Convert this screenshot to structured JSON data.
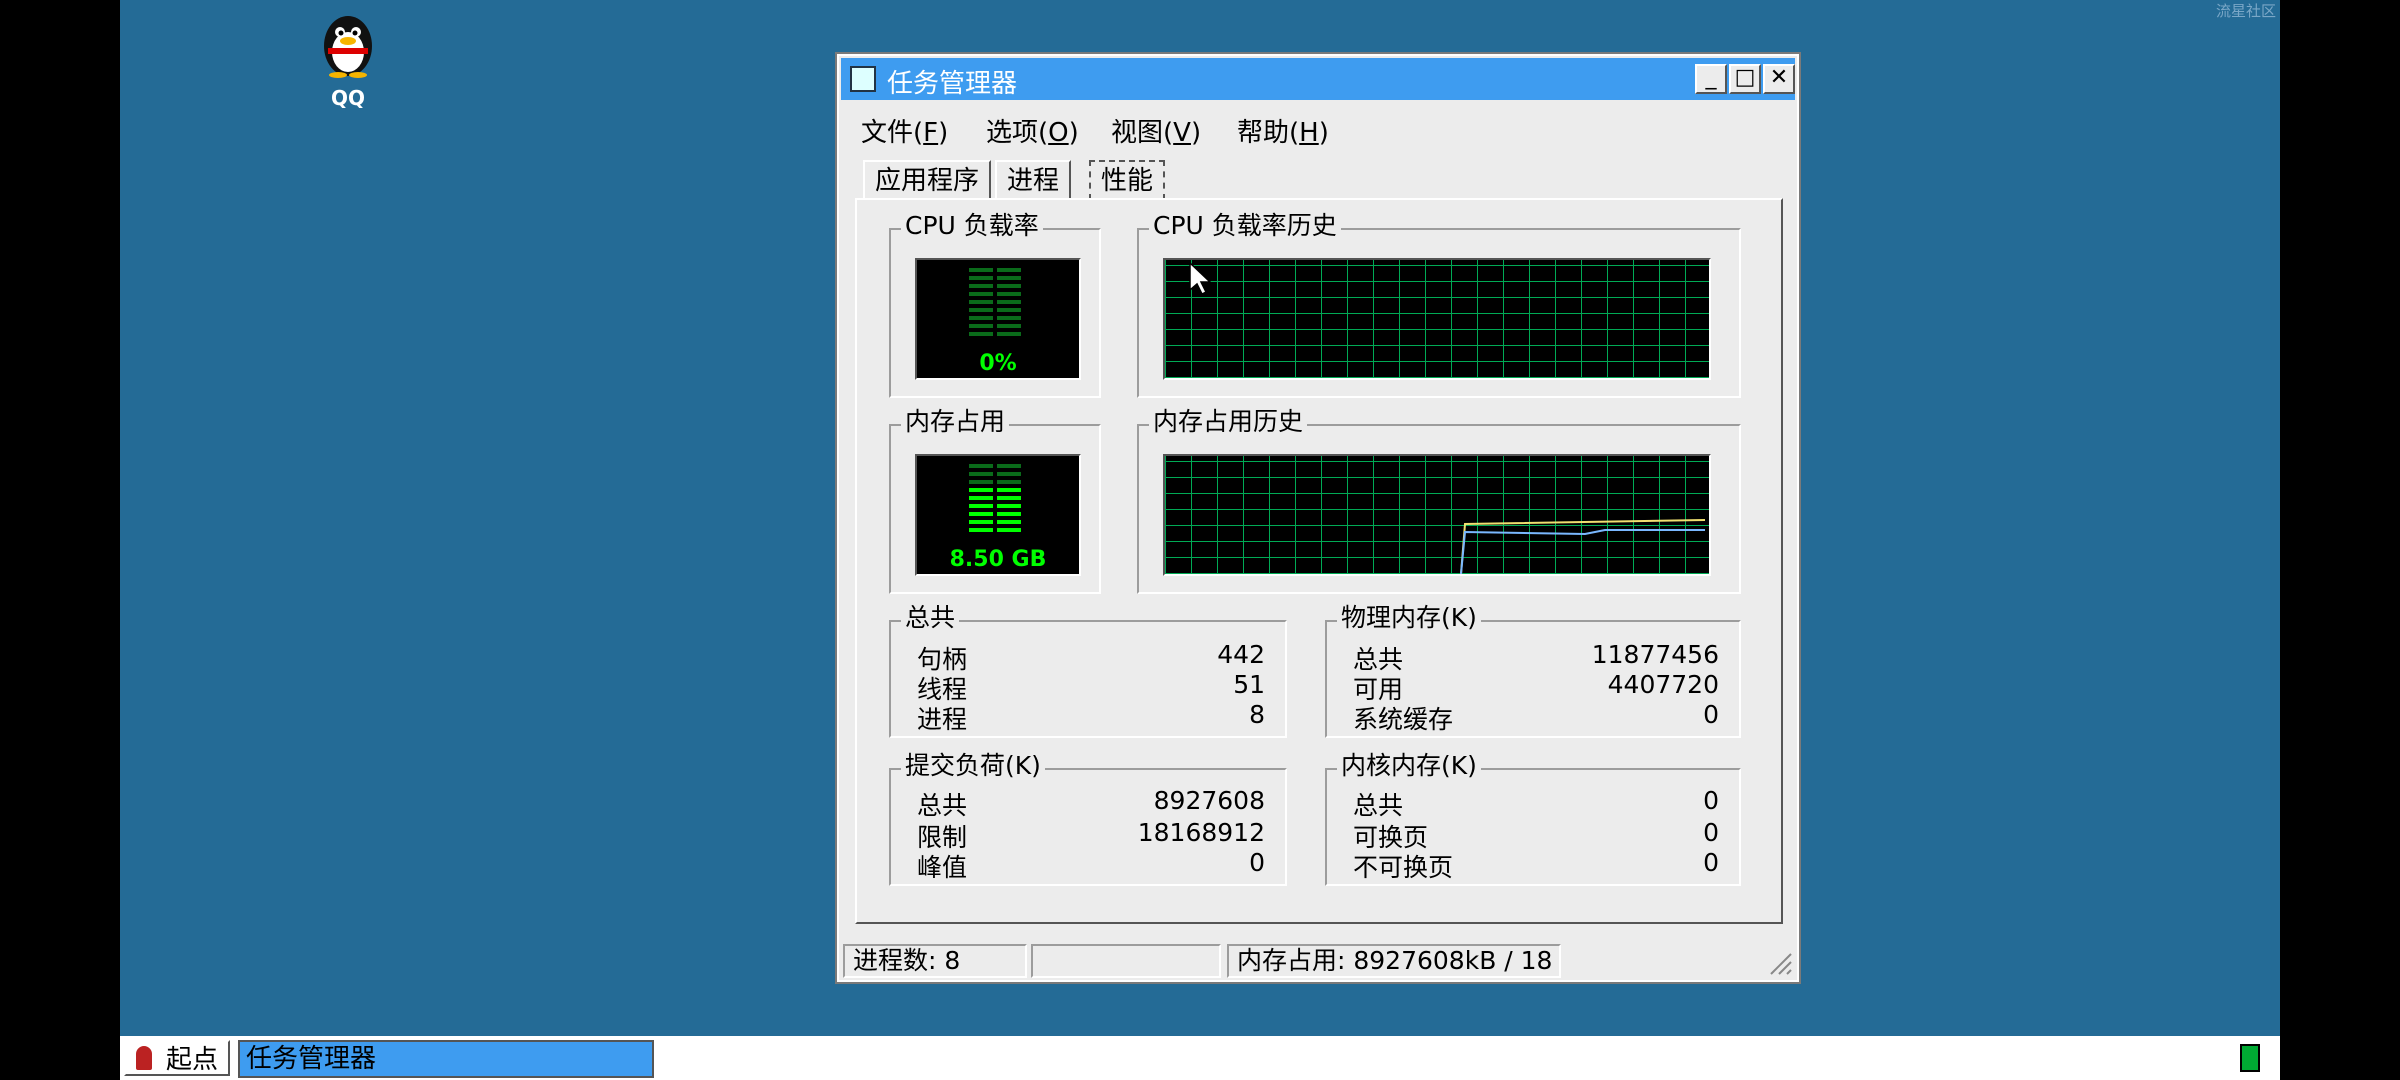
{
  "desktop": {
    "icons": [
      {
        "label": "QQ"
      }
    ],
    "watermark": "流星社区"
  },
  "window": {
    "title": "任务管理器",
    "controls": {
      "minimize": "_",
      "maximize": "□",
      "close": "✕"
    },
    "menu": [
      {
        "label": "文件",
        "key": "F"
      },
      {
        "label": "选项",
        "key": "O"
      },
      {
        "label": "视图",
        "key": "V"
      },
      {
        "label": "帮助",
        "key": "H"
      }
    ],
    "tabs": [
      {
        "label": "应用程序"
      },
      {
        "label": "进程"
      },
      {
        "label": "性能",
        "selected": true
      }
    ]
  },
  "performance": {
    "cpu_usage": {
      "title": "CPU 负载率",
      "value": "0%"
    },
    "cpu_history": {
      "title": "CPU 负载率历史"
    },
    "memory_usage": {
      "title": "内存占用",
      "value": "8.50 GB"
    },
    "memory_history": {
      "title": "内存占用历史"
    },
    "totals": {
      "title": "总共",
      "rows": [
        {
          "label": "句柄",
          "value": "442"
        },
        {
          "label": "线程",
          "value": "51"
        },
        {
          "label": "进程",
          "value": "8"
        }
      ]
    },
    "physical_memory": {
      "title": "物理内存(K)",
      "rows": [
        {
          "label": "总共",
          "value": "11877456"
        },
        {
          "label": "可用",
          "value": "4407720"
        },
        {
          "label": "系统缓存",
          "value": "0"
        }
      ]
    },
    "commit_charge": {
      "title": "提交负荷(K)",
      "rows": [
        {
          "label": "总共",
          "value": "8927608"
        },
        {
          "label": "限制",
          "value": "18168912"
        },
        {
          "label": "峰值",
          "value": "0"
        }
      ]
    },
    "kernel_memory": {
      "title": "内核内存(K)",
      "rows": [
        {
          "label": "总共",
          "value": "0"
        },
        {
          "label": "可换页",
          "value": "0"
        },
        {
          "label": "不可换页",
          "value": "0"
        }
      ]
    }
  },
  "statusbar": {
    "processes": "进程数: 8",
    "memory": "内存占用: 8927608kB / 18"
  },
  "taskbar": {
    "start_label": "起点",
    "task_label": "任务管理器"
  },
  "colors": {
    "desktop": "#246b96",
    "titlebar": "#3e9cf0",
    "meter": "#00ff00"
  }
}
